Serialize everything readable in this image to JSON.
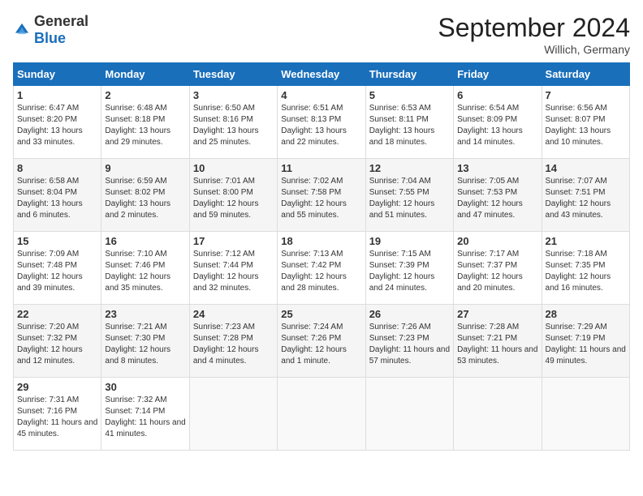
{
  "header": {
    "logo_general": "General",
    "logo_blue": "Blue",
    "month_title": "September 2024",
    "location": "Willich, Germany"
  },
  "weekdays": [
    "Sunday",
    "Monday",
    "Tuesday",
    "Wednesday",
    "Thursday",
    "Friday",
    "Saturday"
  ],
  "weeks": [
    [
      {
        "day": "1",
        "sunrise": "6:47 AM",
        "sunset": "8:20 PM",
        "daylight": "13 hours and 33 minutes."
      },
      {
        "day": "2",
        "sunrise": "6:48 AM",
        "sunset": "8:18 PM",
        "daylight": "13 hours and 29 minutes."
      },
      {
        "day": "3",
        "sunrise": "6:50 AM",
        "sunset": "8:16 PM",
        "daylight": "13 hours and 25 minutes."
      },
      {
        "day": "4",
        "sunrise": "6:51 AM",
        "sunset": "8:13 PM",
        "daylight": "13 hours and 22 minutes."
      },
      {
        "day": "5",
        "sunrise": "6:53 AM",
        "sunset": "8:11 PM",
        "daylight": "13 hours and 18 minutes."
      },
      {
        "day": "6",
        "sunrise": "6:54 AM",
        "sunset": "8:09 PM",
        "daylight": "13 hours and 14 minutes."
      },
      {
        "day": "7",
        "sunrise": "6:56 AM",
        "sunset": "8:07 PM",
        "daylight": "13 hours and 10 minutes."
      }
    ],
    [
      {
        "day": "8",
        "sunrise": "6:58 AM",
        "sunset": "8:04 PM",
        "daylight": "13 hours and 6 minutes."
      },
      {
        "day": "9",
        "sunrise": "6:59 AM",
        "sunset": "8:02 PM",
        "daylight": "13 hours and 2 minutes."
      },
      {
        "day": "10",
        "sunrise": "7:01 AM",
        "sunset": "8:00 PM",
        "daylight": "12 hours and 59 minutes."
      },
      {
        "day": "11",
        "sunrise": "7:02 AM",
        "sunset": "7:58 PM",
        "daylight": "12 hours and 55 minutes."
      },
      {
        "day": "12",
        "sunrise": "7:04 AM",
        "sunset": "7:55 PM",
        "daylight": "12 hours and 51 minutes."
      },
      {
        "day": "13",
        "sunrise": "7:05 AM",
        "sunset": "7:53 PM",
        "daylight": "12 hours and 47 minutes."
      },
      {
        "day": "14",
        "sunrise": "7:07 AM",
        "sunset": "7:51 PM",
        "daylight": "12 hours and 43 minutes."
      }
    ],
    [
      {
        "day": "15",
        "sunrise": "7:09 AM",
        "sunset": "7:48 PM",
        "daylight": "12 hours and 39 minutes."
      },
      {
        "day": "16",
        "sunrise": "7:10 AM",
        "sunset": "7:46 PM",
        "daylight": "12 hours and 35 minutes."
      },
      {
        "day": "17",
        "sunrise": "7:12 AM",
        "sunset": "7:44 PM",
        "daylight": "12 hours and 32 minutes."
      },
      {
        "day": "18",
        "sunrise": "7:13 AM",
        "sunset": "7:42 PM",
        "daylight": "12 hours and 28 minutes."
      },
      {
        "day": "19",
        "sunrise": "7:15 AM",
        "sunset": "7:39 PM",
        "daylight": "12 hours and 24 minutes."
      },
      {
        "day": "20",
        "sunrise": "7:17 AM",
        "sunset": "7:37 PM",
        "daylight": "12 hours and 20 minutes."
      },
      {
        "day": "21",
        "sunrise": "7:18 AM",
        "sunset": "7:35 PM",
        "daylight": "12 hours and 16 minutes."
      }
    ],
    [
      {
        "day": "22",
        "sunrise": "7:20 AM",
        "sunset": "7:32 PM",
        "daylight": "12 hours and 12 minutes."
      },
      {
        "day": "23",
        "sunrise": "7:21 AM",
        "sunset": "7:30 PM",
        "daylight": "12 hours and 8 minutes."
      },
      {
        "day": "24",
        "sunrise": "7:23 AM",
        "sunset": "7:28 PM",
        "daylight": "12 hours and 4 minutes."
      },
      {
        "day": "25",
        "sunrise": "7:24 AM",
        "sunset": "7:26 PM",
        "daylight": "12 hours and 1 minute."
      },
      {
        "day": "26",
        "sunrise": "7:26 AM",
        "sunset": "7:23 PM",
        "daylight": "11 hours and 57 minutes."
      },
      {
        "day": "27",
        "sunrise": "7:28 AM",
        "sunset": "7:21 PM",
        "daylight": "11 hours and 53 minutes."
      },
      {
        "day": "28",
        "sunrise": "7:29 AM",
        "sunset": "7:19 PM",
        "daylight": "11 hours and 49 minutes."
      }
    ],
    [
      {
        "day": "29",
        "sunrise": "7:31 AM",
        "sunset": "7:16 PM",
        "daylight": "11 hours and 45 minutes."
      },
      {
        "day": "30",
        "sunrise": "7:32 AM",
        "sunset": "7:14 PM",
        "daylight": "11 hours and 41 minutes."
      },
      null,
      null,
      null,
      null,
      null
    ]
  ],
  "labels": {
    "sunrise": "Sunrise:",
    "sunset": "Sunset:",
    "daylight": "Daylight:"
  }
}
